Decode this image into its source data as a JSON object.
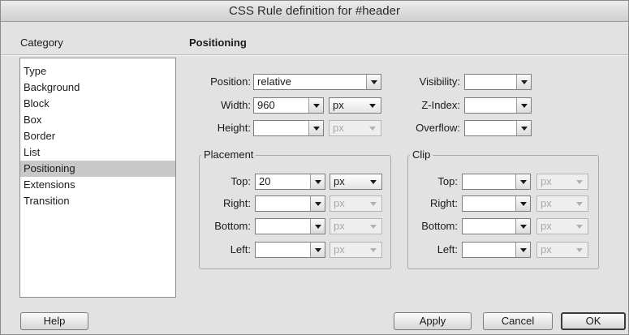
{
  "window": {
    "title": "CSS Rule definition for #header"
  },
  "category": {
    "label": "Category",
    "items": [
      {
        "label": "Type"
      },
      {
        "label": "Background"
      },
      {
        "label": "Block"
      },
      {
        "label": "Box"
      },
      {
        "label": "Border"
      },
      {
        "label": "List"
      },
      {
        "label": "Positioning",
        "selected": true
      },
      {
        "label": "Extensions"
      },
      {
        "label": "Transition"
      }
    ]
  },
  "section": {
    "title": "Positioning"
  },
  "fields": {
    "position": {
      "label": "Position:",
      "value": "relative"
    },
    "width": {
      "label": "Width:",
      "value": "960",
      "unit": "px"
    },
    "height": {
      "label": "Height:",
      "value": "",
      "unit": "px"
    },
    "visibility": {
      "label": "Visibility:",
      "value": ""
    },
    "zindex": {
      "label": "Z-Index:",
      "value": ""
    },
    "overflow": {
      "label": "Overflow:",
      "value": ""
    }
  },
  "placement": {
    "title": "Placement",
    "top": {
      "label": "Top:",
      "value": "20",
      "unit": "px"
    },
    "right": {
      "label": "Right:",
      "value": "",
      "unit": "px"
    },
    "bottom": {
      "label": "Bottom:",
      "value": "",
      "unit": "px"
    },
    "left": {
      "label": "Left:",
      "value": "",
      "unit": "px"
    }
  },
  "clip": {
    "title": "Clip",
    "top": {
      "label": "Top:",
      "value": "",
      "unit": "px"
    },
    "right": {
      "label": "Right:",
      "value": "",
      "unit": "px"
    },
    "bottom": {
      "label": "Bottom:",
      "value": "",
      "unit": "px"
    },
    "left": {
      "label": "Left:",
      "value": "",
      "unit": "px"
    }
  },
  "buttons": {
    "help": "Help",
    "apply": "Apply",
    "cancel": "Cancel",
    "ok": "OK"
  },
  "icons": {
    "dropdown": "chevron-down-icon"
  }
}
